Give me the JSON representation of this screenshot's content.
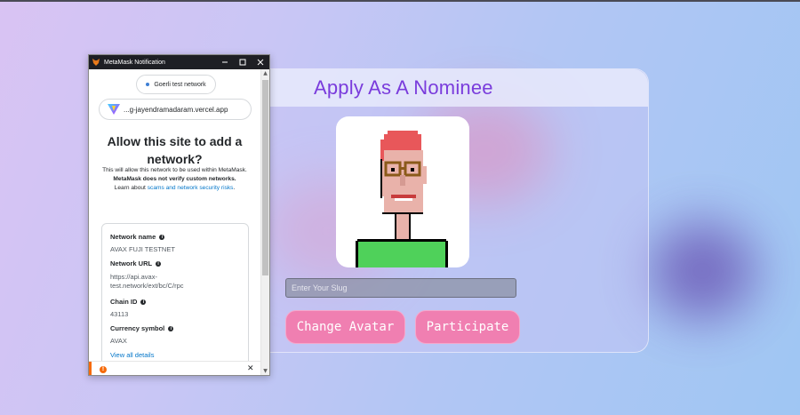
{
  "card": {
    "title": "Apply As A Nominee",
    "slug_placeholder": "Enter Your Slug",
    "change_avatar_label": "Change Avatar",
    "participate_label": "Participate"
  },
  "metamask": {
    "window_title": "MetaMask Notification",
    "network_pill": "Goerli test network",
    "origin": "...g-jayendramadaram.vercel.app",
    "heading": "Allow this site to add a network?",
    "description": "This will allow this network to be used within MetaMask.",
    "warning_bold": "MetaMask does not verify custom networks.",
    "learn_prefix": "Learn about",
    "learn_link": "scams and network security risks",
    "learn_suffix": ".",
    "details": {
      "network_name_label": "Network name",
      "network_name": "AVAX FUJI TESTNET",
      "network_url_label": "Network URL",
      "network_url": "https://api.avax-test.network/ext/bc/C/rpc",
      "network_url_line1": "https://api.avax-",
      "network_url_line2": "test.network/ext/bc/C/rpc",
      "chain_id_label": "Chain ID",
      "chain_id": "43113",
      "currency_label": "Currency symbol",
      "currency": "AVAX",
      "view_all": "View all details"
    }
  },
  "icons": [
    "metamask-fox-icon",
    "minimize-icon",
    "maximize-icon",
    "close-icon",
    "info-icon",
    "vercel-logo-icon",
    "warning-icon"
  ],
  "colors": {
    "title_purple": "#7a3cdc",
    "button_pink": "#f07fb1",
    "metamask_link": "#0376c9",
    "metamask_warning": "#f66a0a"
  }
}
